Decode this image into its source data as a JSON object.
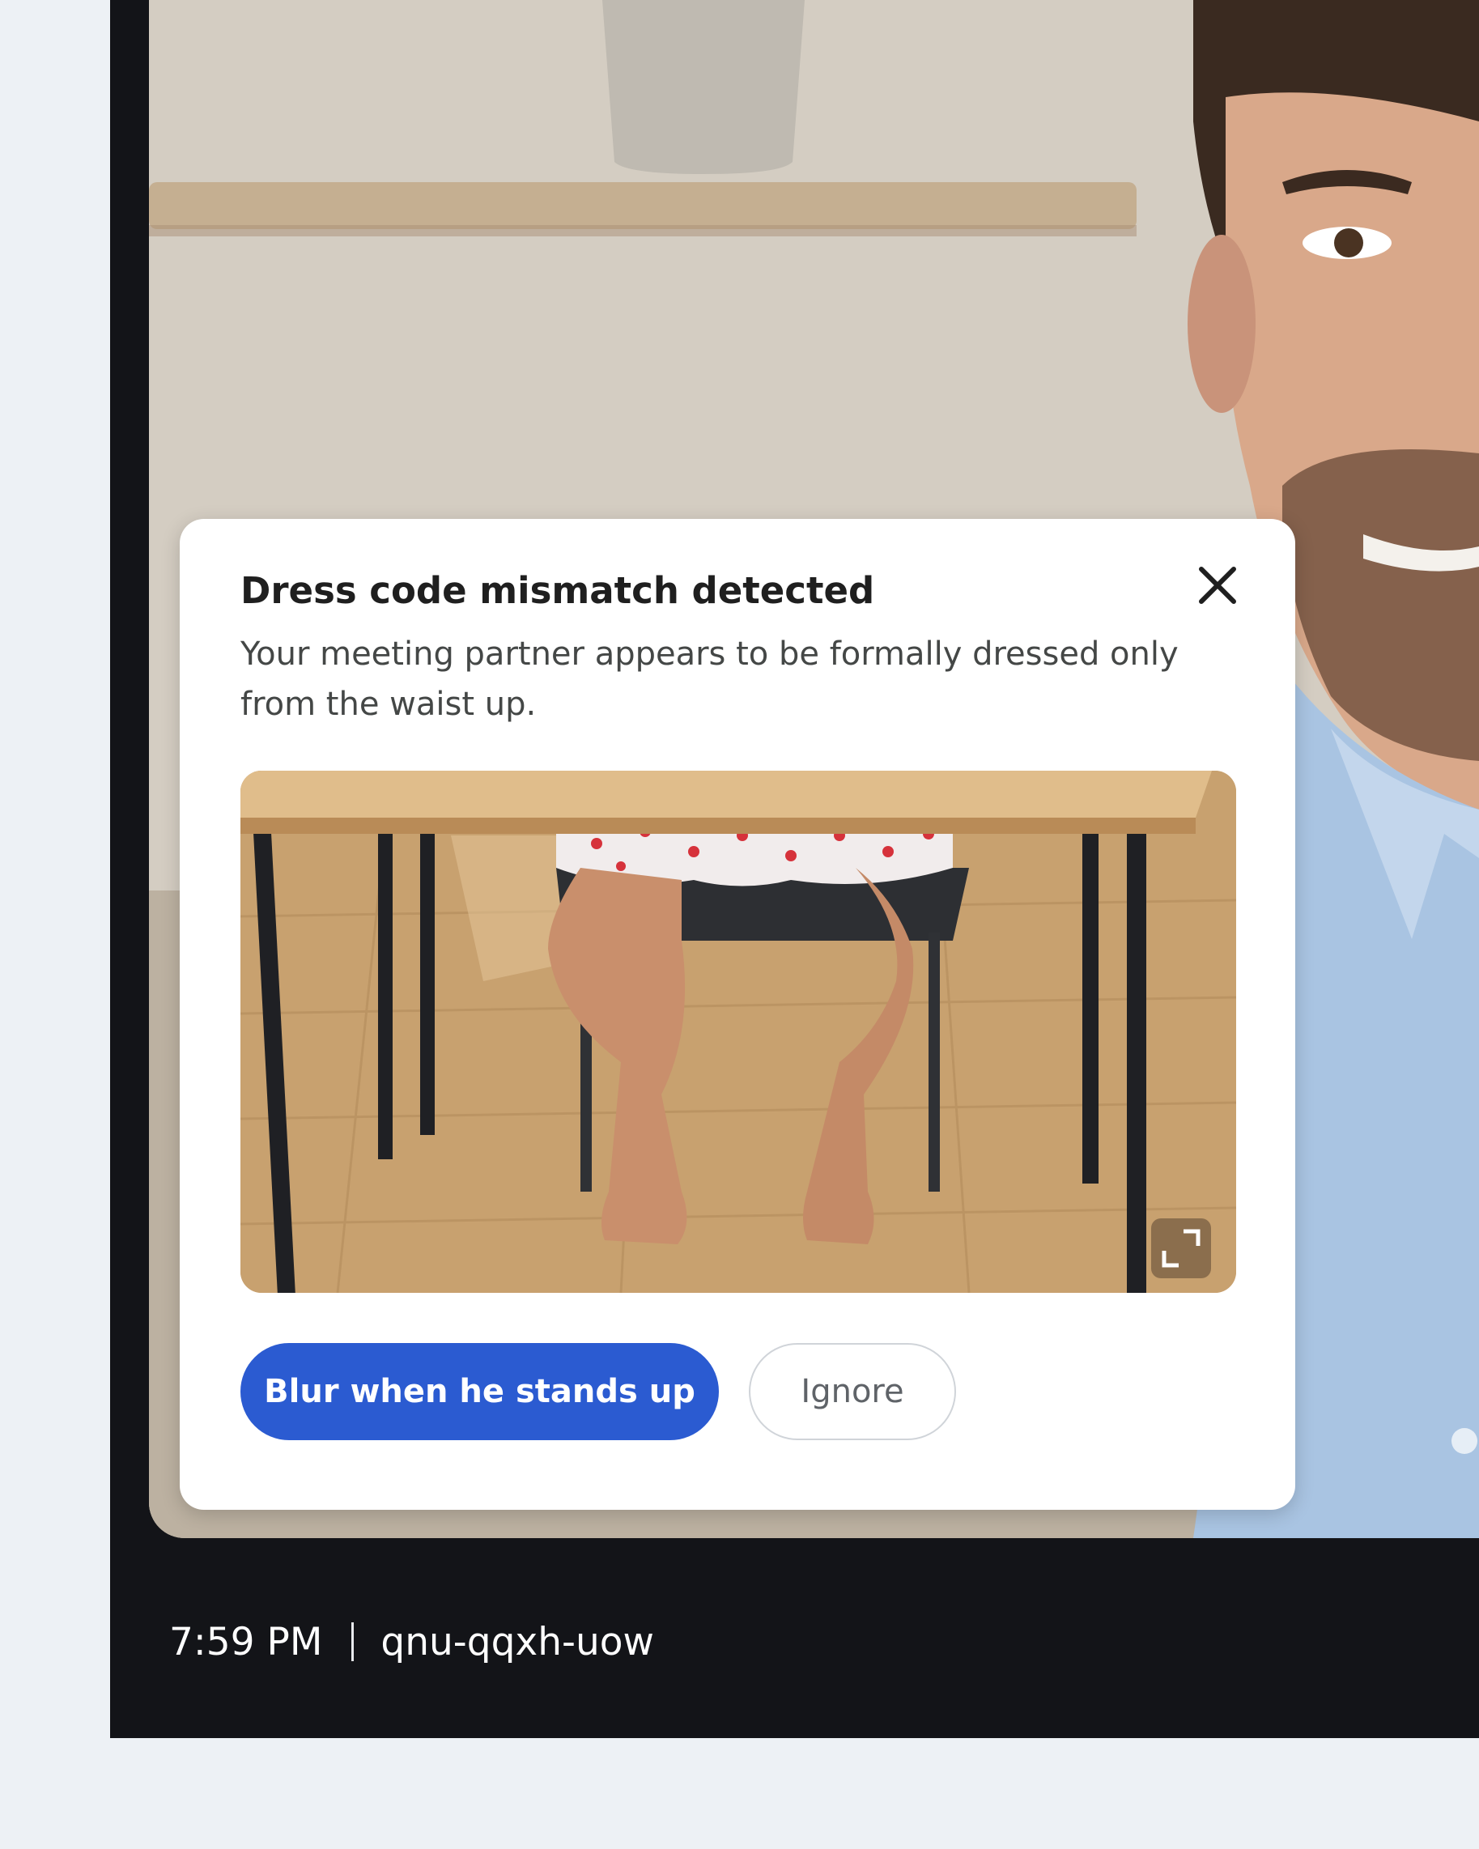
{
  "dialog": {
    "title": "Dress code mismatch detected",
    "body": "Your meeting partner appears to be formally dressed only from the waist up.",
    "primary_button": "Blur when he stands up",
    "secondary_button": "Ignore",
    "close_icon": "close-icon",
    "expand_icon": "expand-icon"
  },
  "meeting": {
    "time": "7:59 PM",
    "code": "qnu-qqxh-uow"
  },
  "colors": {
    "primary": "#2b5bd1",
    "window_background": "#131418",
    "page_background": "#edf1f5"
  }
}
